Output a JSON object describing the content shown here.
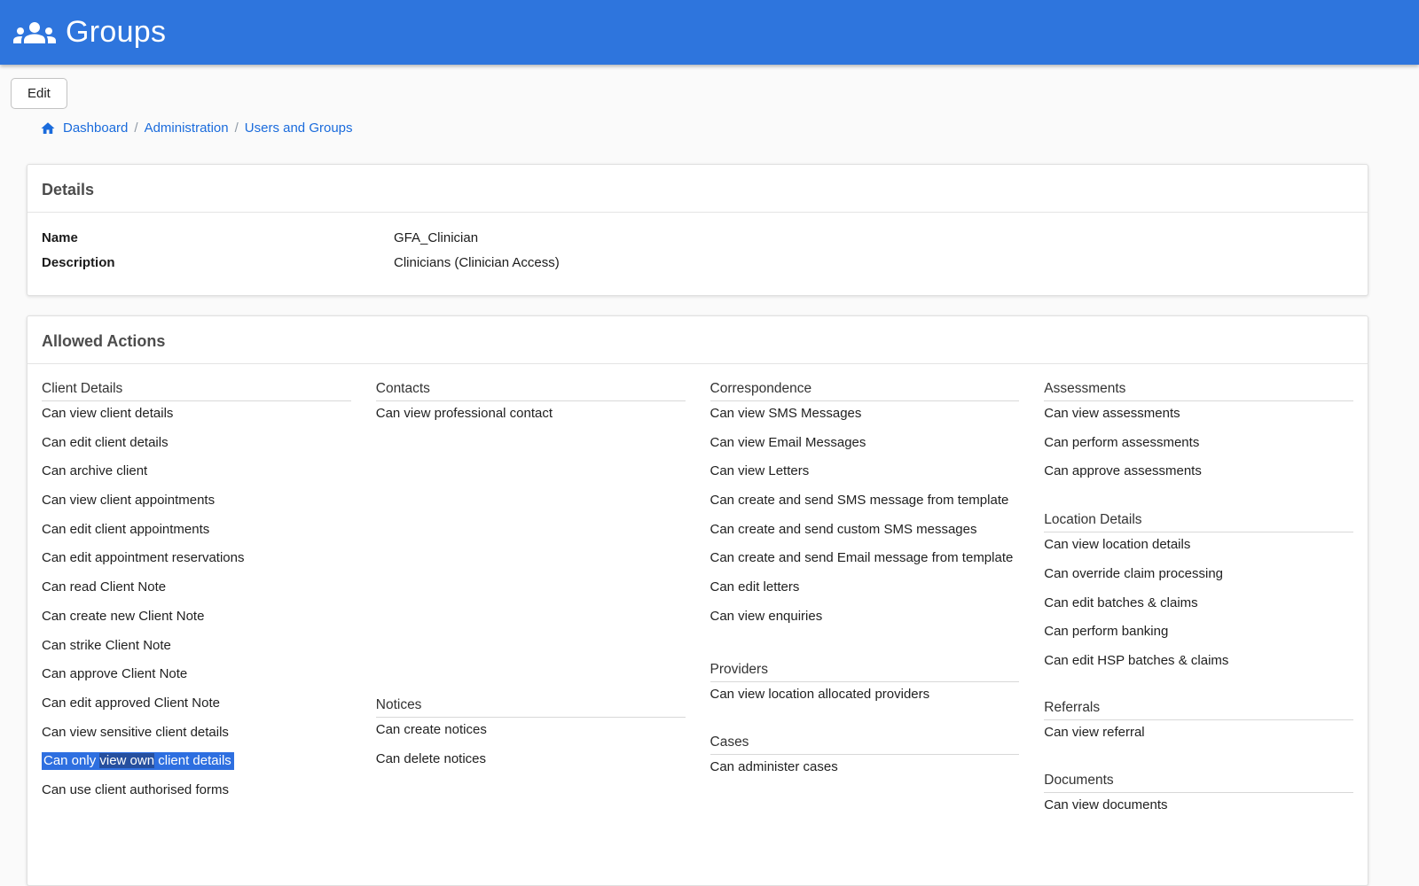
{
  "header": {
    "title": "Groups"
  },
  "toolbar": {
    "edit_label": "Edit"
  },
  "breadcrumb": {
    "separator": "/",
    "items": [
      "Dashboard",
      "Administration",
      "Users and Groups"
    ]
  },
  "details": {
    "title": "Details",
    "fields": [
      {
        "label": "Name",
        "value": "GFA_Clinician"
      },
      {
        "label": "Description",
        "value": "Clinicians (Clinician Access)"
      }
    ]
  },
  "allowed_actions": {
    "title": "Allowed Actions",
    "highlight_colors": {
      "light": "#2e6fe0",
      "dark": "#264f9e"
    },
    "sections": {
      "client_details": {
        "title": "Client Details",
        "items": [
          "Can view client details",
          "Can edit client details",
          "Can archive client",
          "Can view client appointments",
          "Can edit client appointments",
          "Can edit appointment reservations",
          "Can read Client Note",
          "Can create new Client Note",
          "Can strike Client Note",
          "Can approve Client Note",
          "Can edit approved Client Note",
          "Can view sensitive client details",
          {
            "highlight_parts": [
              "Can only ",
              "view own",
              " client details"
            ]
          },
          "Can use client authorised forms"
        ]
      },
      "contacts": {
        "title": "Contacts",
        "items": [
          "Can view professional contact"
        ]
      },
      "notices": {
        "title": "Notices",
        "items": [
          "Can create notices",
          "Can delete notices"
        ]
      },
      "correspondence": {
        "title": "Correspondence",
        "items": [
          "Can view SMS Messages",
          "Can view Email Messages",
          "Can view Letters",
          "Can create and send SMS message from template",
          "Can create and send custom SMS messages",
          "Can create and send Email message from template",
          "Can edit letters",
          "Can view enquiries"
        ]
      },
      "providers": {
        "title": "Providers",
        "items": [
          "Can view location allocated providers"
        ]
      },
      "cases": {
        "title": "Cases",
        "items": [
          "Can administer cases"
        ]
      },
      "assessments": {
        "title": "Assessments",
        "items": [
          "Can view assessments",
          "Can perform assessments",
          "Can approve assessments"
        ]
      },
      "location_details": {
        "title": "Location Details",
        "items": [
          "Can view location details",
          "Can override claim processing",
          "Can edit batches & claims",
          "Can perform banking",
          "Can edit HSP batches & claims"
        ]
      },
      "referrals": {
        "title": "Referrals",
        "items": [
          "Can view referral"
        ]
      },
      "documents": {
        "title": "Documents",
        "items": [
          "Can view documents"
        ]
      }
    }
  }
}
